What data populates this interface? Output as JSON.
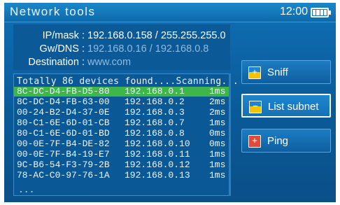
{
  "header": {
    "title": "Network tools",
    "time": "12:00"
  },
  "info": {
    "ipmask_label": "IP/mask :",
    "ipmask_value": "192.168.0.158 / 255.255.255.0",
    "gwdns_label": "Gw/DNS :",
    "gwdns_value": "192.168.0.16 / 192.168.0.8",
    "dest_label": "Destination :",
    "dest_value": "www.com"
  },
  "list": {
    "header": "Totally 86 devices found....Scanning...",
    "rows": [
      {
        "mac": "8C-DC-D4-FB-D5-80",
        "ip": "192.168.0.1",
        "time": "1ms"
      },
      {
        "mac": "8C-DC-D4-FB-63-00",
        "ip": "192.168.0.2",
        "time": "2ms"
      },
      {
        "mac": "00-24-B2-D4-37-0E",
        "ip": "192.168.0.3",
        "time": "2ms"
      },
      {
        "mac": "80-C1-6E-6D-01-CB",
        "ip": "192.168.0.7",
        "time": "1ms"
      },
      {
        "mac": "80-C1-6E-6D-01-BD",
        "ip": "192.168.0.8",
        "time": "0ms"
      },
      {
        "mac": "00-0E-7F-B4-DE-82",
        "ip": "192.168.0.10",
        "time": "0ms"
      },
      {
        "mac": "00-0E-7F-B4-19-E7",
        "ip": "192.168.0.11",
        "time": "1ms"
      },
      {
        "mac": "9C-B6-54-F3-79-2B",
        "ip": "192.168.0.12",
        "time": "1ms"
      },
      {
        "mac": "78-AC-C0-97-76-1A",
        "ip": "192.168.0.13",
        "time": "1ms"
      }
    ],
    "more": "..."
  },
  "buttons": {
    "sniff": {
      "label": "Sniff",
      "icon": "+"
    },
    "list_subnet": {
      "label": "List subnet",
      "icon": "−"
    },
    "ping": {
      "label": "Ping",
      "icon": "+"
    }
  },
  "colors": {
    "accent": "#0f6fb4",
    "selected_row": "#3fb64a",
    "dim_text": "#8fbbe0"
  }
}
